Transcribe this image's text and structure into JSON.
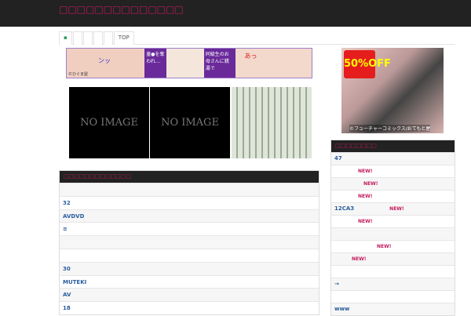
{
  "header": {
    "title": "□□□□□□□□□□□□□□"
  },
  "nav": {
    "tabs": [
      "▪",
      "",
      "",
      "",
      "",
      "TOP"
    ]
  },
  "banner": {
    "credit": "©ひぐま屋",
    "texts": [
      "ンッ",
      "童●を奪われ…",
      "同級生のお母さんに銭湯で",
      "あっ"
    ]
  },
  "thumbnails": [
    {
      "label": "NO IMAGE"
    },
    {
      "label": "NO IMAGE"
    },
    {
      "label": ""
    }
  ],
  "side_ad": {
    "sale": "50%OFF",
    "credit": "©フューチャーコミックス/おてもと屋"
  },
  "main_widget": {
    "title": "□□□□□□□□□□□□□",
    "rows": [
      "",
      "32",
      "AVDVD",
      "≡",
      "",
      "",
      "30",
      "MUTEKI",
      "AV",
      "18"
    ]
  },
  "side_widget": {
    "title": "□□□□□□□□",
    "new_label": "NEW!",
    "rows": [
      {
        "text": "47",
        "new": false,
        "indent": 0
      },
      {
        "text": "",
        "new": true,
        "indent": 30
      },
      {
        "text": "",
        "new": true,
        "indent": 37
      },
      {
        "text": "",
        "new": true,
        "indent": 30
      },
      {
        "text": "12CA3",
        "new": true,
        "indent": 45
      },
      {
        "text": "",
        "new": true,
        "indent": 30
      },
      {
        "text": "",
        "new": false,
        "indent": 0
      },
      {
        "text": "",
        "new": true,
        "indent": 54
      },
      {
        "text": "",
        "new": true,
        "indent": 22
      },
      {
        "text": "",
        "new": false,
        "indent": 0
      },
      {
        "text": "→",
        "new": false,
        "indent": 0
      },
      {
        "text": "",
        "new": false,
        "indent": 0
      },
      {
        "text": "www",
        "new": false,
        "indent": 0
      }
    ]
  }
}
